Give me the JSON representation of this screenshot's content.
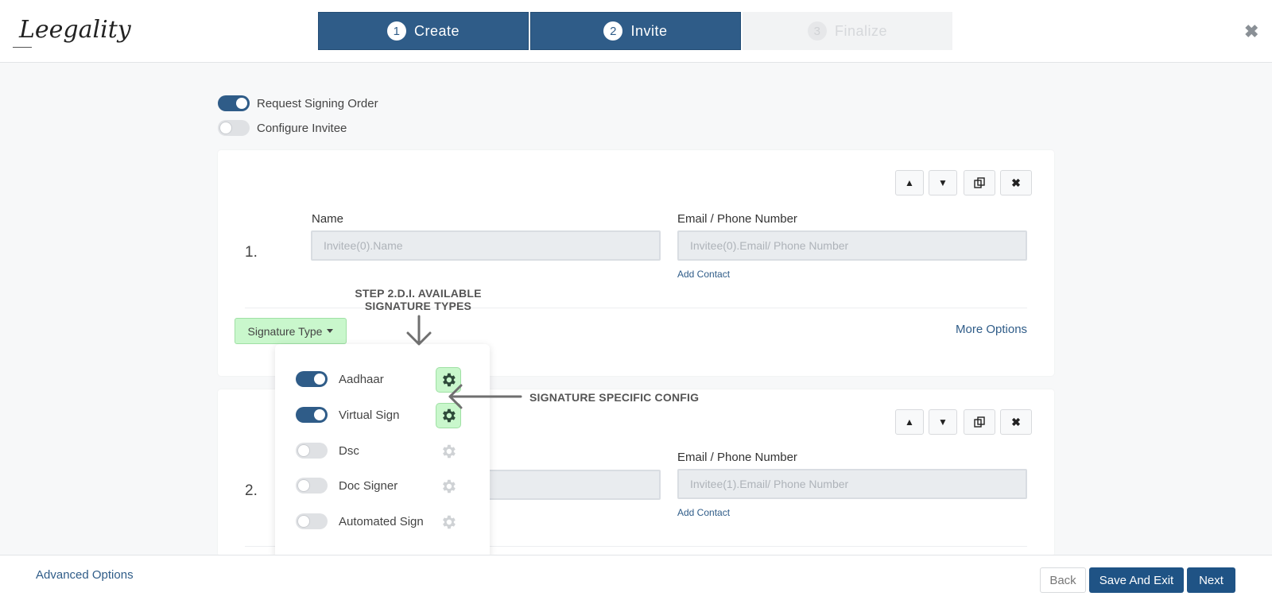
{
  "header": {
    "logo_text": "Leegality",
    "steps": [
      {
        "num": "1",
        "label": "Create",
        "state": "active"
      },
      {
        "num": "2",
        "label": "Invite",
        "state": "active"
      },
      {
        "num": "3",
        "label": "Finalize",
        "state": "inactive"
      }
    ],
    "close_icon": "close-icon"
  },
  "options": {
    "request_signing_order": {
      "label": "Request Signing Order",
      "enabled": true
    },
    "configure_invitee": {
      "label": "Configure Invitee",
      "enabled": false
    }
  },
  "invitees": [
    {
      "number": "1.",
      "name_label": "Name",
      "name_placeholder": "Invitee(0).Name",
      "email_label": "Email / Phone Number",
      "email_placeholder": "Invitee(0).Email/ Phone Number",
      "add_contact": "Add Contact",
      "signature_type_button": "Signature Type",
      "more_options": "More Options"
    },
    {
      "number": "2.",
      "email_label": "Email / Phone Number",
      "email_placeholder": "Invitee(1).Email/ Phone Number",
      "add_contact": "Add Contact"
    }
  ],
  "signature_types": [
    {
      "label": "Aadhaar",
      "enabled": true
    },
    {
      "label": "Virtual Sign",
      "enabled": true
    },
    {
      "label": "Dsc",
      "enabled": false
    },
    {
      "label": "Doc Signer",
      "enabled": false
    },
    {
      "label": "Automated Sign",
      "enabled": false
    }
  ],
  "annotations": {
    "step_label_line1": "STEP 2.D.I. AVAILABLE",
    "step_label_line2": "SIGNATURE TYPES",
    "config_label": "SIGNATURE SPECIFIC CONFIG"
  },
  "footer": {
    "advanced_options": "Advanced Options",
    "back": "Back",
    "save_and_exit": "Save And Exit",
    "next": "Next"
  },
  "colors": {
    "primary": "#2f5c88",
    "button_dark": "#1f5385",
    "green_highlight": "#c9f7cc"
  }
}
